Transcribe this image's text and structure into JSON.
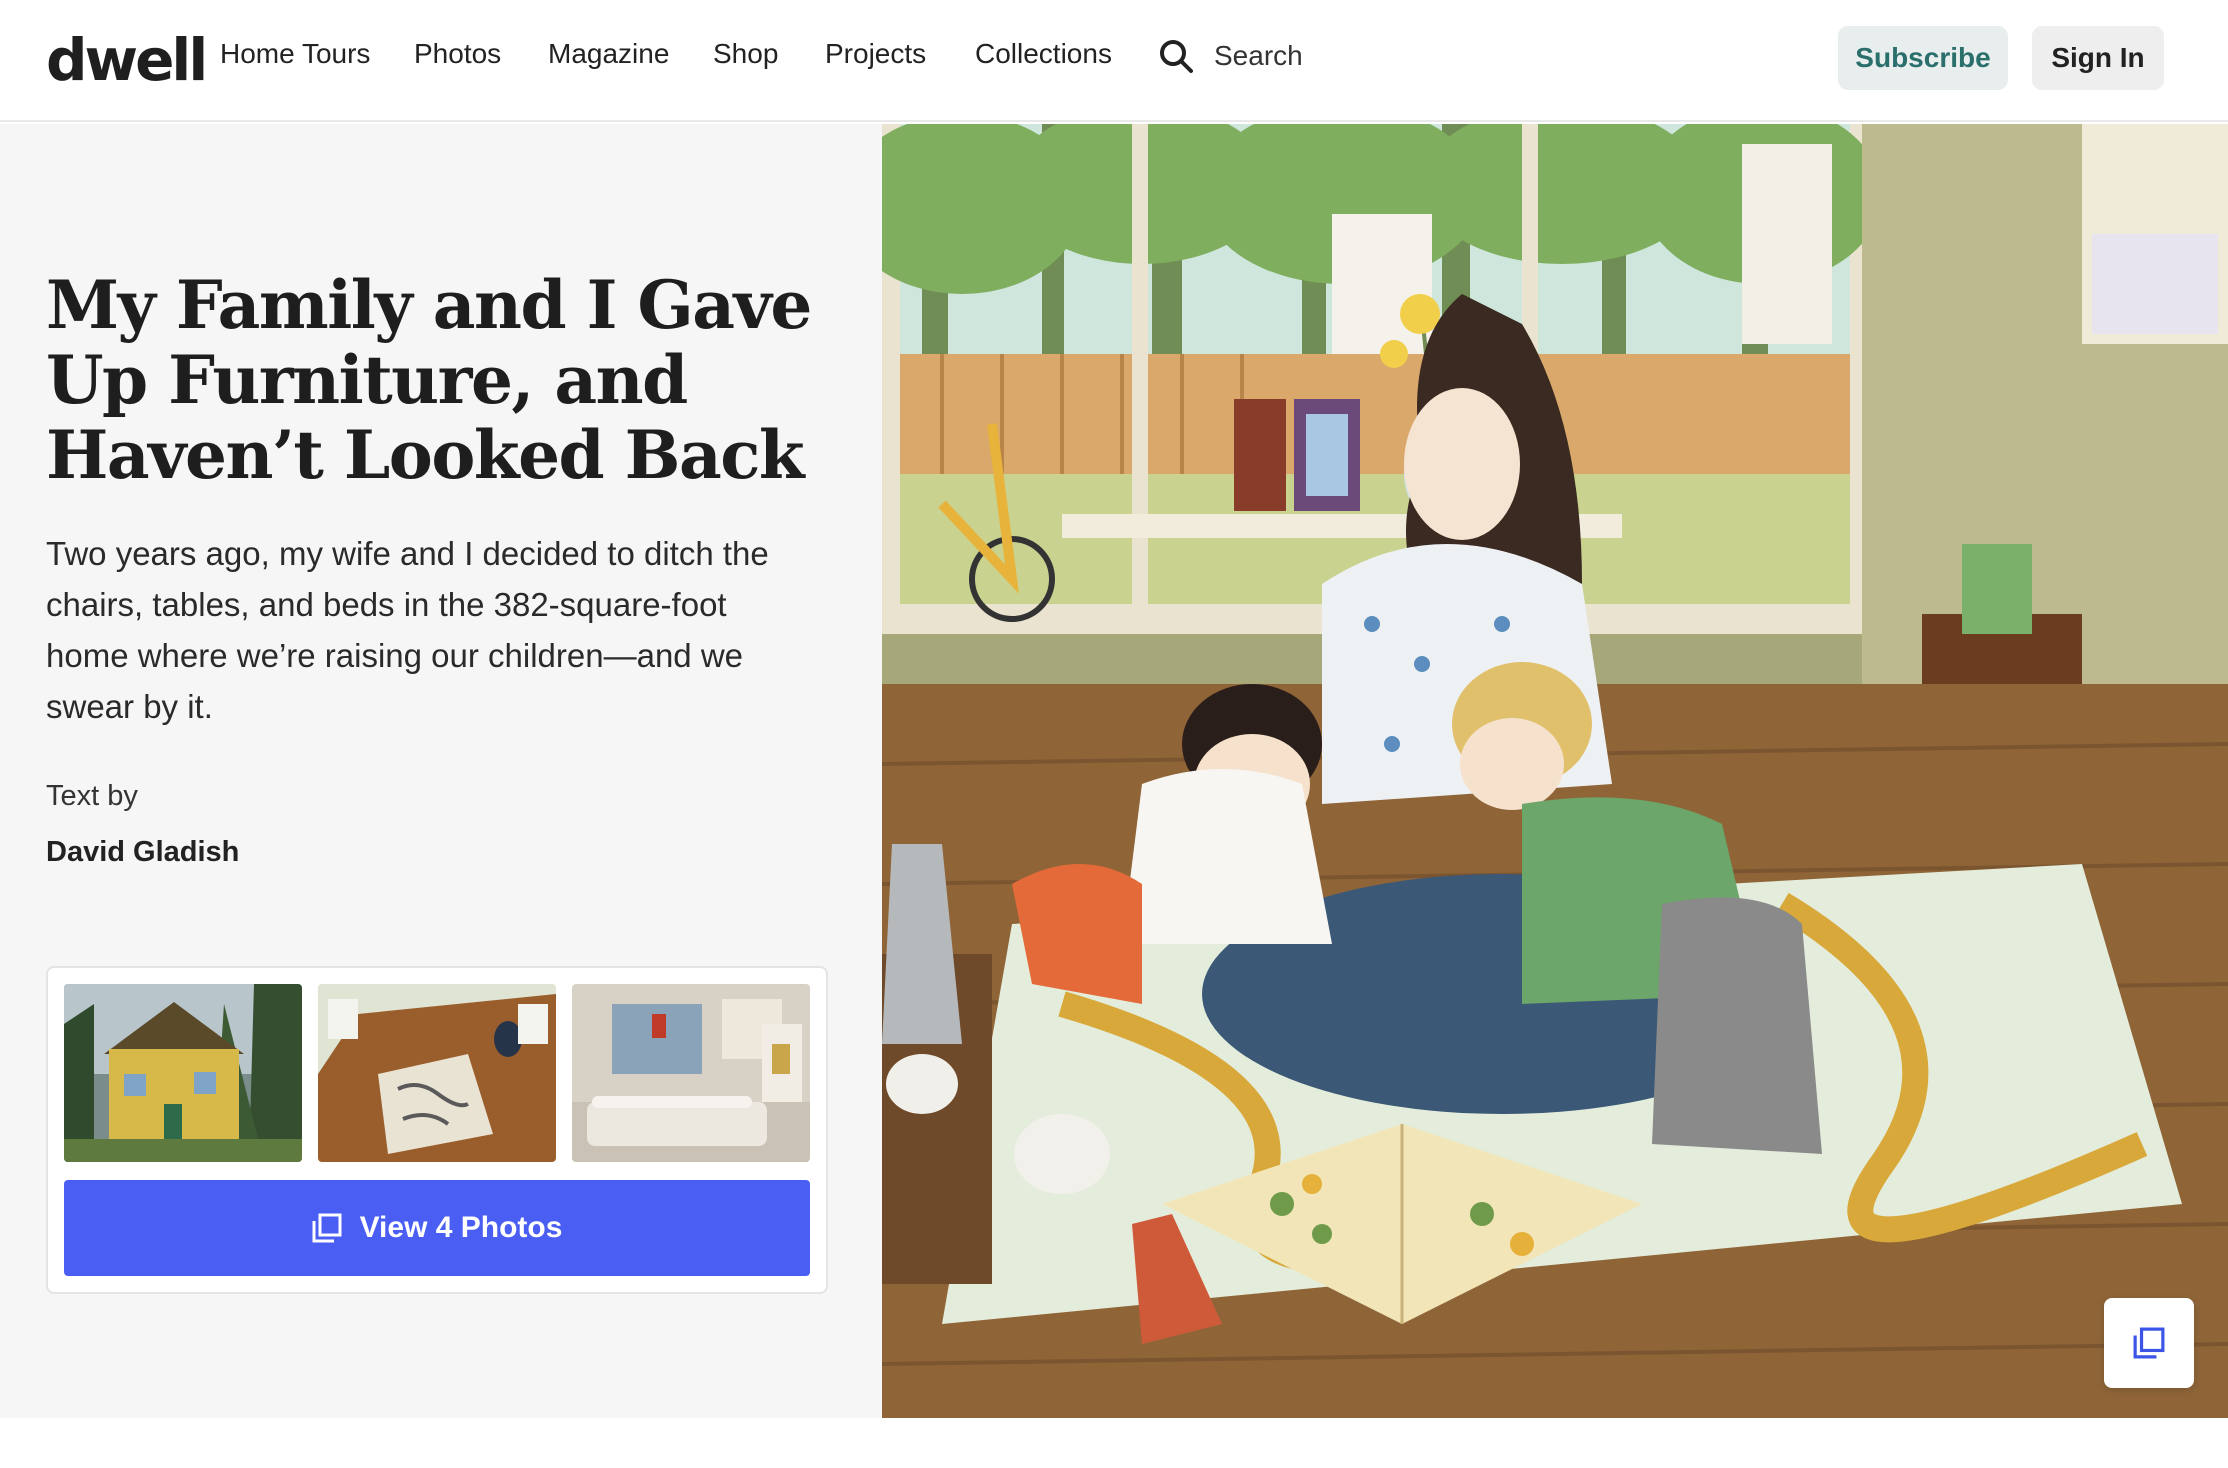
{
  "brand": {
    "logo": "dwell"
  },
  "nav": {
    "items": [
      "Home Tours",
      "Photos",
      "Magazine",
      "Shop",
      "Projects",
      "Collections"
    ],
    "search_label": "Search",
    "subscribe_label": "Subscribe",
    "signin_label": "Sign In"
  },
  "article": {
    "title": "My Family and I Gave Up Furniture, and Haven’t Looked Back",
    "dek": "Two years ago, my wife and I decided to ditch the chairs, tables, and beds in the 382-square-foot home where we’re raising our children—and we swear by it.",
    "byline_label": "Text by",
    "author": "David Gladish"
  },
  "gallery": {
    "thumbnails": [
      "yellow-house-exterior",
      "room-with-wood-floor-and-rug",
      "bedroom-with-floor-mattress"
    ],
    "button_label": "View 4 Photos"
  },
  "hero": {
    "illustration": "mother-reading-to-two-children-on-floor-mat"
  },
  "colors": {
    "accent_button": "#4a5ef3",
    "subscribe_text": "#2a6f6c",
    "subscribe_bg": "#e8eeee",
    "panel_bg": "#f6f6f6"
  },
  "icons": [
    "search-icon",
    "gallery-icon"
  ]
}
